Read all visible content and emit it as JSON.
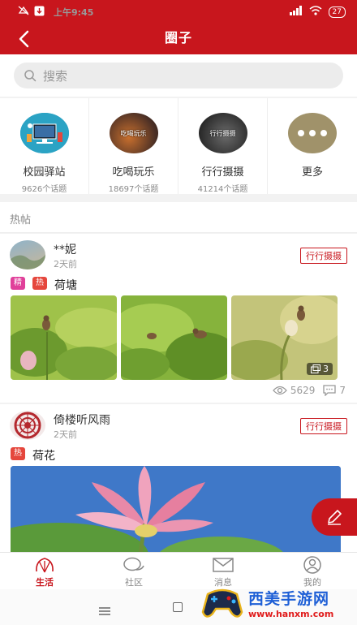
{
  "status_bar": {
    "time": "上午9:45",
    "battery": "27"
  },
  "navbar": {
    "title": "圈子"
  },
  "search": {
    "placeholder": "搜索"
  },
  "categories": [
    {
      "name": "校园驿站",
      "count": "9626个话题",
      "icon": "campus-computer-image"
    },
    {
      "name": "吃喝玩乐",
      "count": "18697个话题",
      "icon": "food-fun-image",
      "image_text": "吃喝玩乐"
    },
    {
      "name": "行行摄摄",
      "count": "41214个话题",
      "icon": "photography-image",
      "image_text": "行行摄摄"
    },
    {
      "name": "更多",
      "count": "",
      "icon": "more-dots-icon"
    }
  ],
  "hot_section": {
    "title": "热帖"
  },
  "posts": [
    {
      "author": "**妮",
      "time": "2天前",
      "tag": "行行摄摄",
      "badges": [
        "精",
        "热"
      ],
      "title": "荷塘",
      "image_count": "3",
      "views": "5629",
      "comments": "7"
    },
    {
      "author": "倚楼听风雨",
      "time": "2天前",
      "tag": "行行摄摄",
      "badges": [
        "热"
      ],
      "title": "荷花"
    }
  ],
  "tabs": [
    {
      "label": "生活",
      "icon": "leaf-icon",
      "active": true
    },
    {
      "label": "社区",
      "icon": "chat-bubbles-icon"
    },
    {
      "label": "消息",
      "icon": "envelope-icon"
    },
    {
      "label": "我的",
      "icon": "user-icon"
    }
  ],
  "watermark": {
    "title": "西美手游网",
    "url": "www.hanxm.com"
  },
  "colors": {
    "brand": "#c8161d",
    "watermark_blue": "#1e5fd6",
    "watermark_red": "#e01c1c"
  }
}
